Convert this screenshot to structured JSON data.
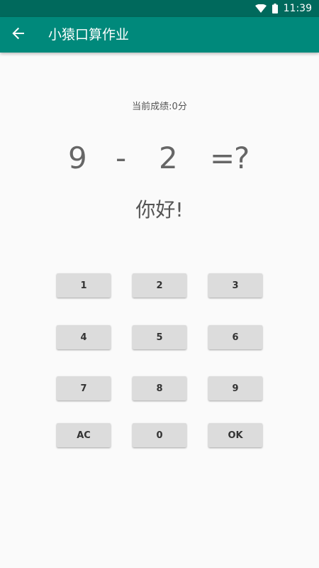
{
  "status_bar": {
    "time": "11:39"
  },
  "app_bar": {
    "title": "小猿口算作业"
  },
  "score": {
    "text": "当前成绩:0分"
  },
  "question": {
    "left": "9",
    "operator": "-",
    "right": "2",
    "equals": "=",
    "unknown": "?"
  },
  "greeting": "你好!",
  "keypad": {
    "k1": "1",
    "k2": "2",
    "k3": "3",
    "k4": "4",
    "k5": "5",
    "k6": "6",
    "k7": "7",
    "k8": "8",
    "k9": "9",
    "clear": "AC",
    "k0": "0",
    "ok": "OK"
  }
}
